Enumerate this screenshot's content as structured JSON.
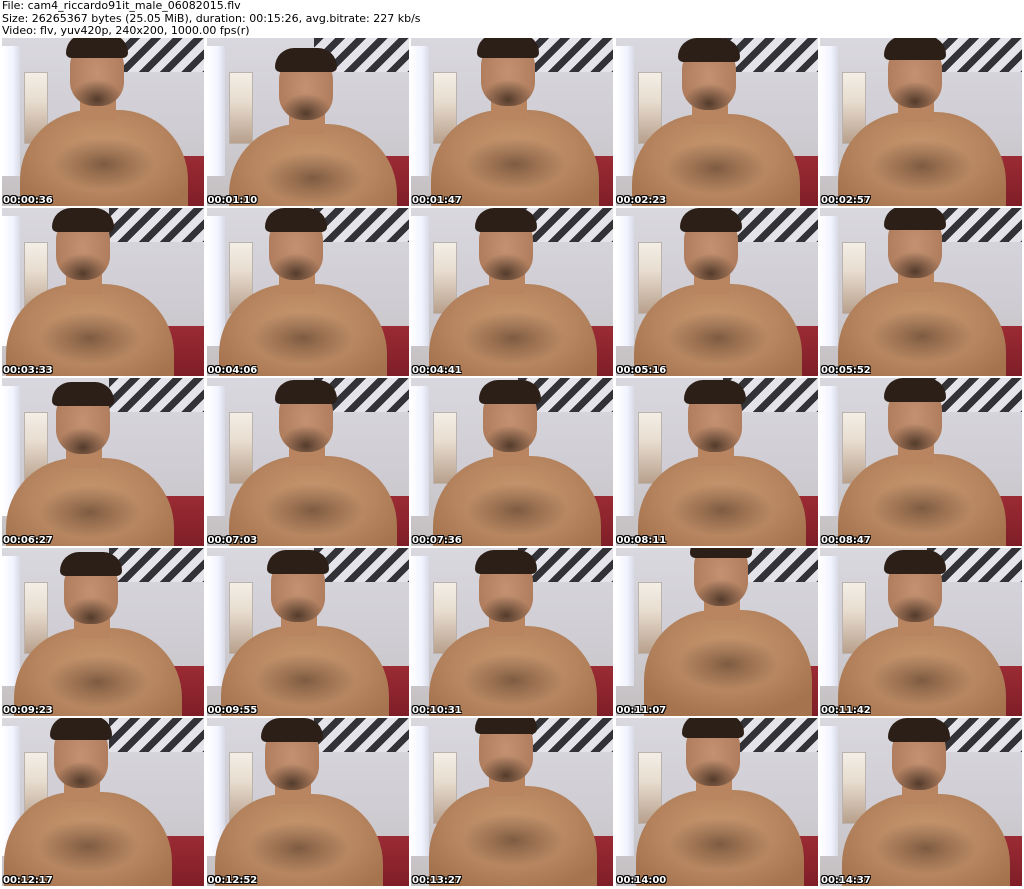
{
  "header": {
    "file_line": "File: cam4_riccardo91it_male_06082015.flv",
    "size_line": "Size: 26265367 bytes (25.05 MiB), duration: 00:15:26, avg.bitrate: 227 kb/s",
    "video_line": "Video: flv, yuv420p, 240x200, 1000.00 fps(r)"
  },
  "thumbnails": [
    {
      "timestamp": "00:00:36"
    },
    {
      "timestamp": "00:01:10"
    },
    {
      "timestamp": "00:01:47"
    },
    {
      "timestamp": "00:02:23"
    },
    {
      "timestamp": "00:02:57"
    },
    {
      "timestamp": "00:03:33"
    },
    {
      "timestamp": "00:04:06"
    },
    {
      "timestamp": "00:04:41"
    },
    {
      "timestamp": "00:05:16"
    },
    {
      "timestamp": "00:05:52"
    },
    {
      "timestamp": "00:06:27"
    },
    {
      "timestamp": "00:07:03"
    },
    {
      "timestamp": "00:07:36"
    },
    {
      "timestamp": "00:08:11"
    },
    {
      "timestamp": "00:08:47"
    },
    {
      "timestamp": "00:09:23"
    },
    {
      "timestamp": "00:09:55"
    },
    {
      "timestamp": "00:10:31"
    },
    {
      "timestamp": "00:11:07"
    },
    {
      "timestamp": "00:11:42"
    },
    {
      "timestamp": "00:12:17"
    },
    {
      "timestamp": "00:12:52"
    },
    {
      "timestamp": "00:13:27"
    },
    {
      "timestamp": "00:14:00"
    },
    {
      "timestamp": "00:14:37"
    }
  ]
}
